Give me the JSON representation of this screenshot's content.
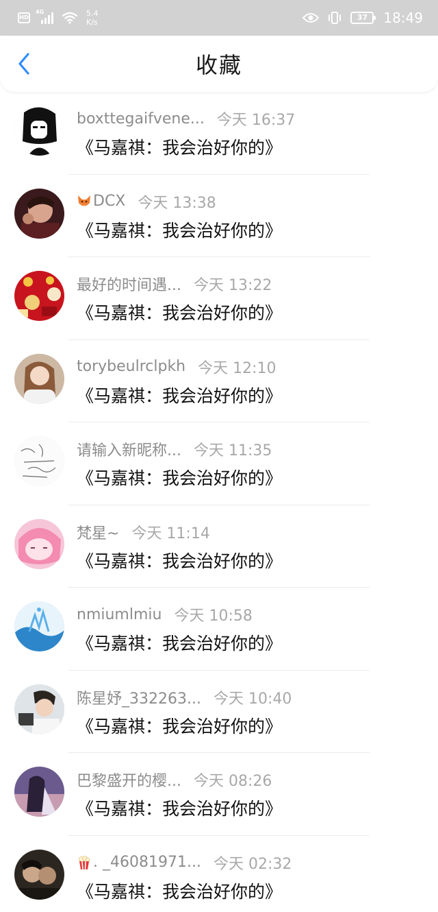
{
  "status_bar": {
    "hd_label": "HD",
    "network_label": "4G",
    "speed_value": "5.4",
    "speed_unit": "K/s",
    "battery_level": "37",
    "time": "18:49"
  },
  "nav": {
    "title": "收藏",
    "accent_color": "#2f8cff"
  },
  "items": [
    {
      "username": "boxttegaifvene...",
      "time": "今天 16:37",
      "message": "《马嘉祺：我会治好你的》",
      "avatar_icon": "avatar-bw-girl"
    },
    {
      "username": "DCX",
      "username_prefix_icon": "fox-emoji-icon",
      "time": "今天 13:38",
      "message": "《马嘉祺：我会治好你的》",
      "avatar_icon": "avatar-boy-photo"
    },
    {
      "username": "最好的时间遇...",
      "time": "今天 13:22",
      "message": "《马嘉祺：我会治好你的》",
      "avatar_icon": "avatar-red-lanterns"
    },
    {
      "username": "torybeulrclpkh",
      "time": "今天 12:10",
      "message": "《马嘉祺：我会治好你的》",
      "avatar_icon": "avatar-girl-photo"
    },
    {
      "username": "请输入新昵称...",
      "time": "今天 11:35",
      "message": "《马嘉祺：我会治好你的》",
      "avatar_icon": "avatar-handwriting"
    },
    {
      "username": "梵星~",
      "time": "今天 11:14",
      "message": "《马嘉祺：我会治好你的》",
      "avatar_icon": "avatar-pink-anime"
    },
    {
      "username": "nmiumlmiu",
      "time": "今天 10:58",
      "message": "《马嘉祺：我会治好你的》",
      "avatar_icon": "avatar-water-splash"
    },
    {
      "username": "陈星妤_332263...",
      "time": "今天 10:40",
      "message": "《马嘉祺：我会治好你的》",
      "avatar_icon": "avatar-boy-studio"
    },
    {
      "username": "巴黎盛开的樱...",
      "time": "今天 08:26",
      "message": "《马嘉祺：我会治好你的》",
      "avatar_icon": "avatar-anime-dusk"
    },
    {
      "username": ". _46081971...",
      "username_prefix_icon": "popcorn-emoji-icon",
      "time": "今天 02:32",
      "message": "《马嘉祺：我会治好你的》",
      "avatar_icon": "avatar-couple-dark"
    }
  ]
}
